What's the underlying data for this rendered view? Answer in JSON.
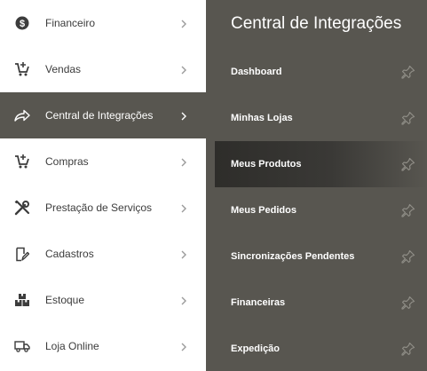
{
  "sidebar": {
    "items": [
      {
        "label": "Financeiro",
        "icon": "dollar-coin-icon",
        "active": false
      },
      {
        "label": "Vendas",
        "icon": "cart-add-icon",
        "active": false
      },
      {
        "label": "Central de Integrações",
        "icon": "share-arrow-icon",
        "active": true
      },
      {
        "label": "Compras",
        "icon": "cart-add-icon",
        "active": false
      },
      {
        "label": "Prestação de Serviços",
        "icon": "tools-icon",
        "active": false
      },
      {
        "label": "Cadastros",
        "icon": "edit-document-icon",
        "active": false
      },
      {
        "label": "Estoque",
        "icon": "boxes-icon",
        "active": false
      },
      {
        "label": "Loja Online",
        "icon": "delivery-truck-icon",
        "active": false
      }
    ]
  },
  "submenu": {
    "title": "Central de Integrações",
    "items": [
      {
        "label": "Dashboard",
        "highlighted": false
      },
      {
        "label": "Minhas Lojas",
        "highlighted": false
      },
      {
        "label": "Meus Produtos",
        "highlighted": true
      },
      {
        "label": "Meus Pedidos",
        "highlighted": false
      },
      {
        "label": "Sincronizações Pendentes",
        "highlighted": false
      },
      {
        "label": "Financeiras",
        "highlighted": false
      },
      {
        "label": "Expedição",
        "highlighted": false
      }
    ]
  },
  "colors": {
    "panel_bg": "#585650",
    "active_bg": "#585650",
    "text_dark": "#3c3c3c",
    "icon_dark": "#3c3c3c",
    "highlight_dark": "#2e2d2a",
    "pin_color": "#8f8d86"
  }
}
